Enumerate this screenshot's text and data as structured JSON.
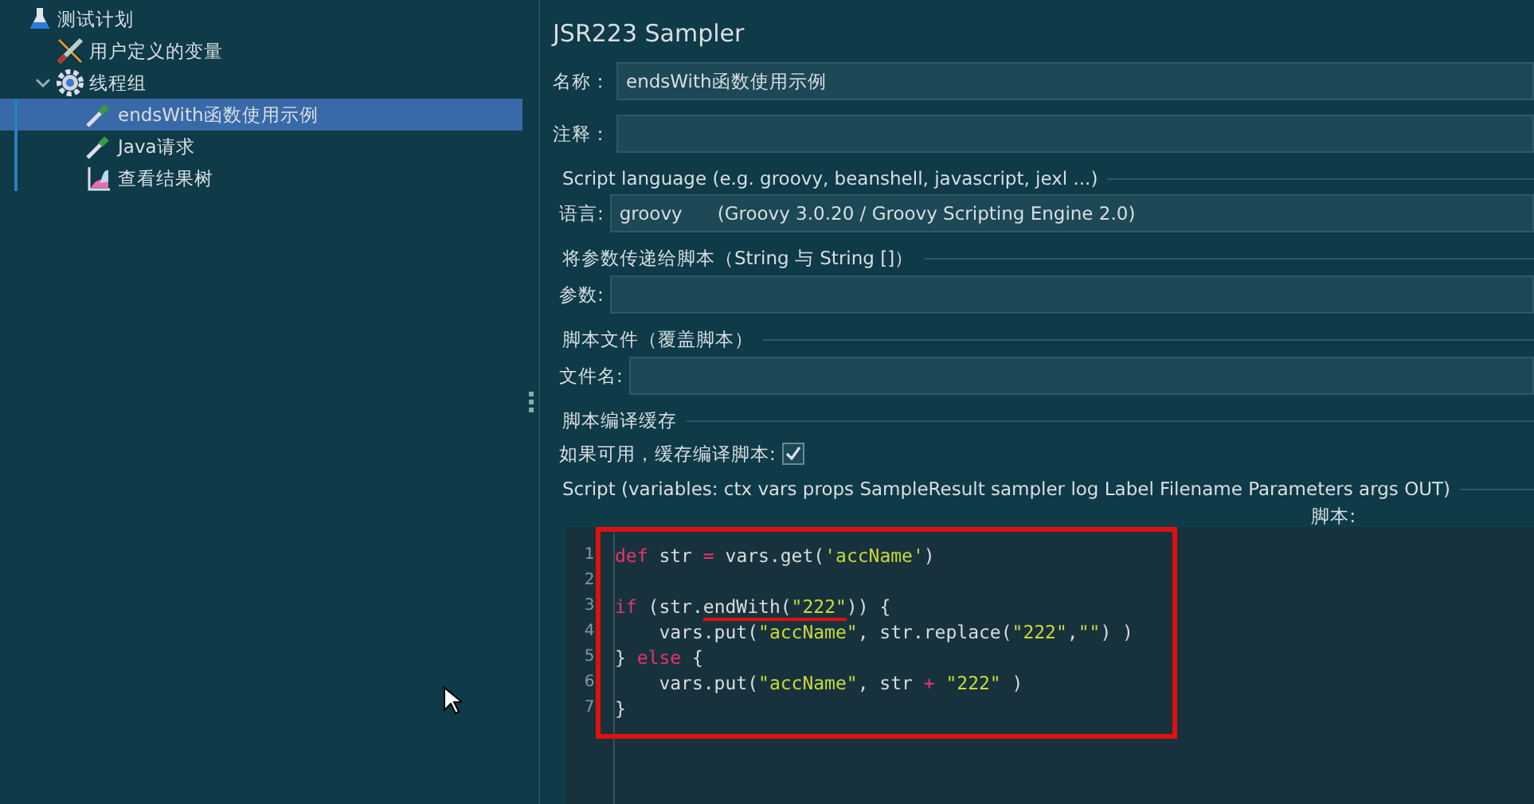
{
  "tree": [
    {
      "label": "测试计划",
      "kind": "plan",
      "selected": false,
      "children": [
        {
          "label": "用户定义的变量",
          "kind": "variables",
          "selected": false
        },
        {
          "label": "线程组",
          "kind": "threadgroup",
          "selected": false,
          "expanded": true,
          "children": [
            {
              "label": "endsWith函数使用示例",
              "kind": "sampler",
              "selected": true
            },
            {
              "label": "Java请求",
              "kind": "sampler",
              "selected": false
            },
            {
              "label": "查看结果树",
              "kind": "listener",
              "selected": false
            }
          ]
        }
      ]
    }
  ],
  "panel": {
    "title": "JSR223 Sampler",
    "name": {
      "label": "名称：",
      "value": "endsWith函数使用示例"
    },
    "comment": {
      "label": "注释："
    },
    "language_group": "Script language (e.g. groovy, beanshell, javascript, jexl ...)",
    "language": {
      "label": "语言:",
      "value": "groovy",
      "engine": "(Groovy 3.0.20 / Groovy Scripting Engine 2.0)"
    },
    "params_group": "将参数传递给脚本（String 与 String []）",
    "params": {
      "label": "参数:"
    },
    "file_group": "脚本文件（覆盖脚本）",
    "file": {
      "label": "文件名:"
    },
    "cache_group": "脚本编译缓存",
    "cache": {
      "label": "如果可用，缓存编译脚本:",
      "checked": true
    },
    "script_group": "Script (variables: ctx vars props SampleResult sampler log Label Filename Parameters args OUT)",
    "script_label": "脚本:",
    "code": [
      {
        "number": "1",
        "tokens": [
          {
            "text": "def",
            "kind": "keyword"
          },
          {
            "text": " str ",
            "kind": "plain"
          },
          {
            "text": "=",
            "kind": "operator"
          },
          {
            "text": " vars.get(",
            "kind": "plain"
          },
          {
            "text": "'accName'",
            "kind": "string"
          },
          {
            "text": ")",
            "kind": "plain"
          }
        ]
      },
      {
        "number": "2"
      },
      {
        "number": "3",
        "tokens": [
          {
            "text": "if",
            "kind": "keyword"
          },
          {
            "text": " (str.",
            "kind": "plain"
          },
          {
            "text": "endWith(",
            "kind": "plain",
            "underlined": true
          },
          {
            "text": "\"222\"",
            "kind": "string",
            "underlined": true
          },
          {
            "text": ")) {",
            "kind": "plain"
          }
        ]
      },
      {
        "number": "4",
        "tokens": [
          {
            "text": "    vars.put(",
            "kind": "plain"
          },
          {
            "text": "\"accName\"",
            "kind": "string"
          },
          {
            "text": ", str.replace(",
            "kind": "plain"
          },
          {
            "text": "\"222\"",
            "kind": "string"
          },
          {
            "text": ",",
            "kind": "plain"
          },
          {
            "text": "\"\"",
            "kind": "string"
          },
          {
            "text": ") )",
            "kind": "plain"
          }
        ]
      },
      {
        "number": "5",
        "tokens": [
          {
            "text": "}",
            "kind": "plain"
          },
          {
            "text": " else",
            "kind": "keyword"
          },
          {
            "text": " {",
            "kind": "plain"
          }
        ]
      },
      {
        "number": "6",
        "tokens": [
          {
            "text": "    vars.put(",
            "kind": "plain"
          },
          {
            "text": "\"accName\"",
            "kind": "string"
          },
          {
            "text": ", str ",
            "kind": "plain"
          },
          {
            "text": "+ ",
            "kind": "operator"
          },
          {
            "text": "\"222\"",
            "kind": "string"
          },
          {
            "text": " )",
            "kind": "plain"
          }
        ]
      },
      {
        "number": "7",
        "tokens": [
          {
            "text": "}",
            "kind": "plain"
          }
        ]
      }
    ]
  }
}
